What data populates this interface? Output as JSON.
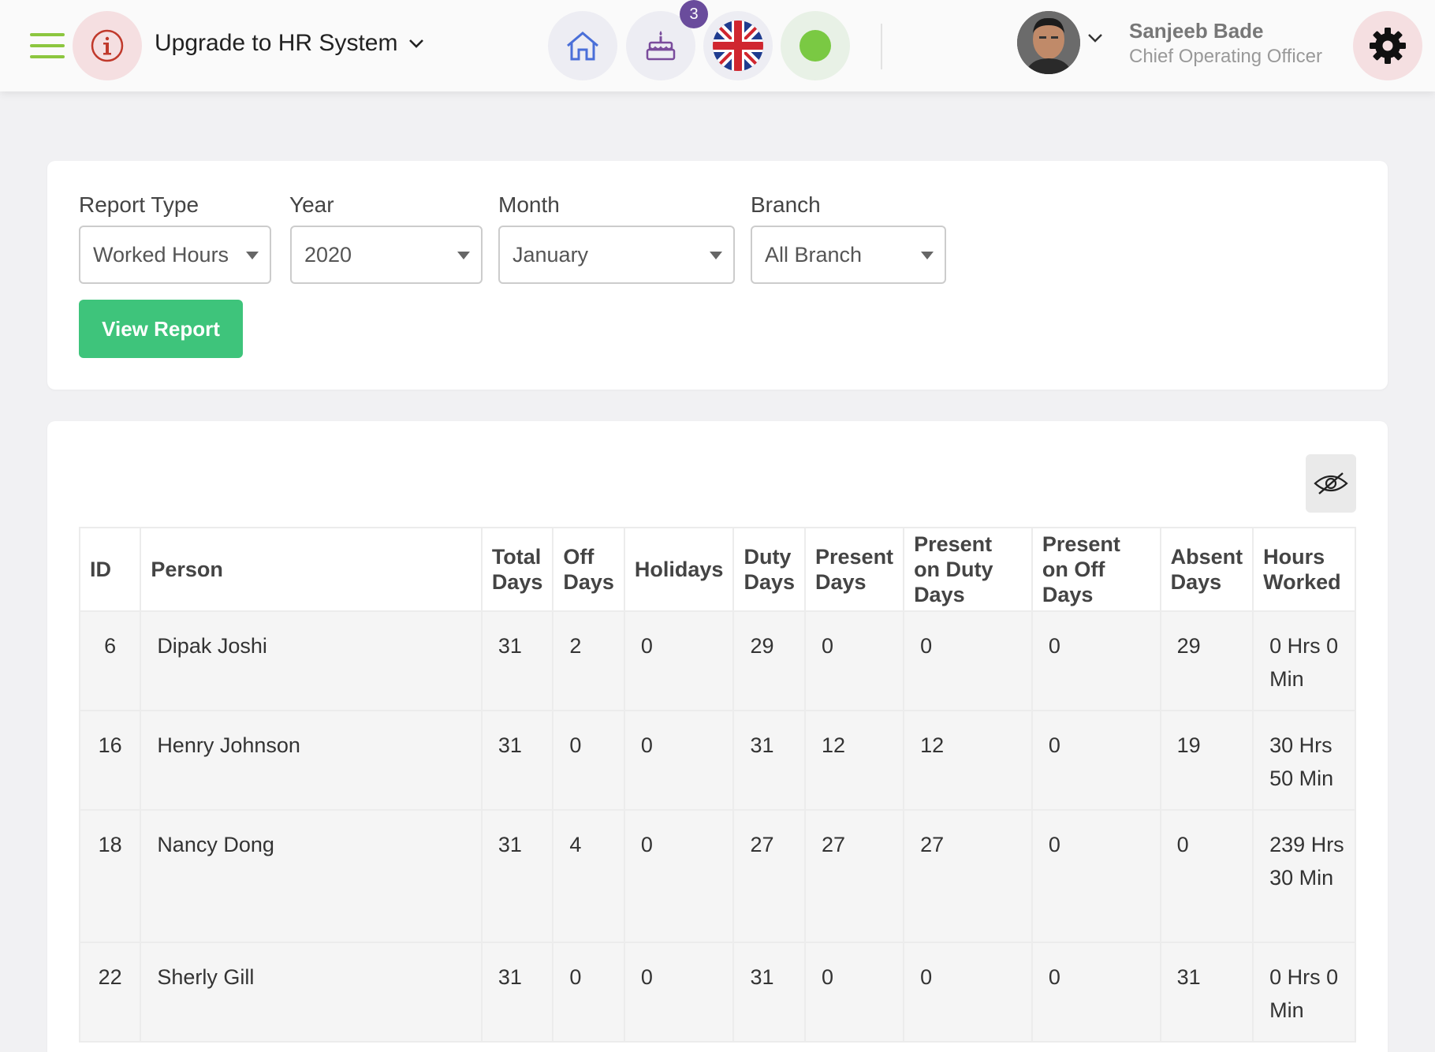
{
  "header": {
    "upgrade_title": "Upgrade to HR System",
    "notification_count": "3",
    "user_name": "Sanjeeb Bade",
    "user_role": "Chief Operating Officer",
    "icons": [
      "menu-icon",
      "info-icon",
      "home-icon",
      "cake-icon",
      "uk-flag-icon",
      "online-status-icon",
      "gear-icon"
    ]
  },
  "filters": {
    "report_type_label": "Report Type",
    "report_type_value": "Worked Hours",
    "year_label": "Year",
    "year_value": "2020",
    "month_label": "Month",
    "month_value": "January",
    "branch_label": "Branch",
    "branch_value": "All Branch",
    "view_button": "View Report"
  },
  "table": {
    "headers": [
      "ID",
      "Person",
      "Total Days",
      "Off Days",
      "Holidays",
      "Duty Days",
      "Present Days",
      "Present on Duty Days",
      "Present on Off Days",
      "Absent Days",
      "Hours Worked"
    ],
    "rows": [
      [
        "6",
        "Dipak Joshi",
        "31",
        "2",
        "0",
        "29",
        "0",
        "0",
        "0",
        "29",
        "0 Hrs 0 Min"
      ],
      [
        "16",
        "Henry Johnson",
        "31",
        "0",
        "0",
        "31",
        "12",
        "12",
        "0",
        "19",
        "30 Hrs 50 Min"
      ],
      [
        "18",
        "Nancy Dong",
        "31",
        "4",
        "0",
        "27",
        "27",
        "27",
        "0",
        "0",
        "239 Hrs 30 Min"
      ],
      [
        "22",
        "Sherly Gill",
        "31",
        "0",
        "0",
        "31",
        "0",
        "0",
        "0",
        "31",
        "0 Hrs 0 Min"
      ]
    ]
  },
  "colors": {
    "accent_green": "#3ec47b",
    "menu_green": "#8cc63f",
    "badge_purple": "#6a4c9c",
    "info_red": "#c0392b"
  }
}
